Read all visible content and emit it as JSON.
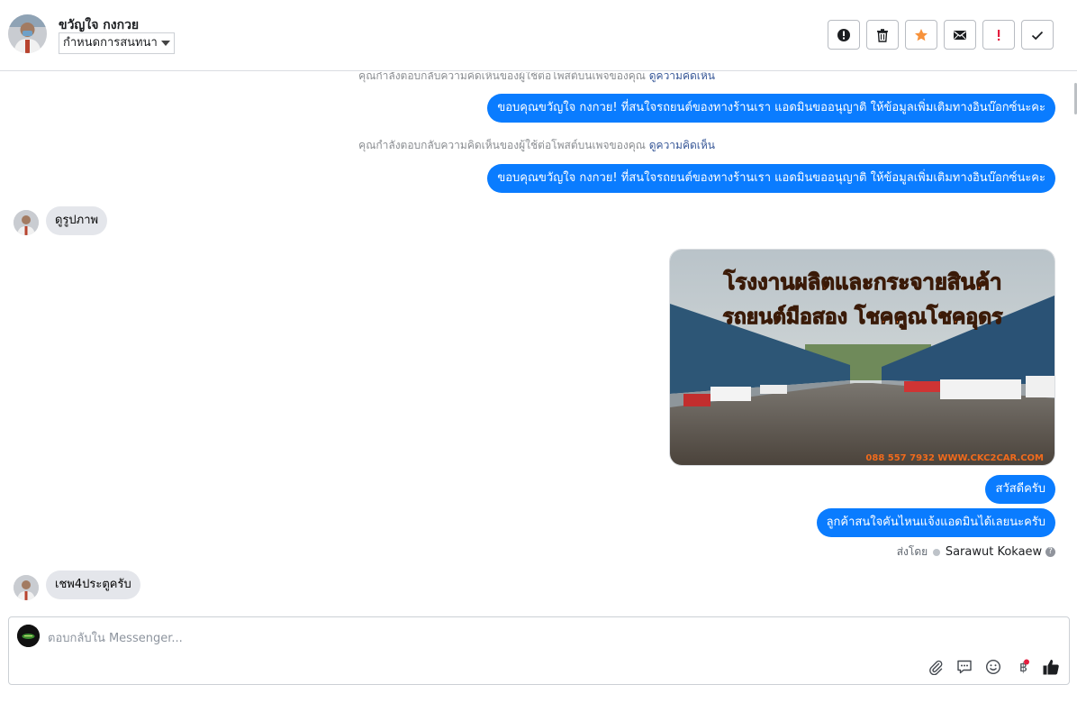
{
  "header": {
    "contact_name": "ขวัญใจ กงกวย",
    "conversation_select": "กำหนดการสนทนา",
    "toolbar": [
      {
        "name": "mark-spam-button",
        "icon": "alert-circle-icon"
      },
      {
        "name": "delete-button",
        "icon": "trash-icon"
      },
      {
        "name": "star-button",
        "icon": "star-icon",
        "color": "#f7923b"
      },
      {
        "name": "mark-unread-button",
        "icon": "envelope-icon"
      },
      {
        "name": "follow-up-button",
        "icon": "exclamation-icon",
        "color": "#e41e3f"
      },
      {
        "name": "mark-done-button",
        "icon": "checkmark-icon"
      }
    ]
  },
  "messages": {
    "sys1_text": "คุณกำลังตอบกลับความคิดเห็นของผู้ใช้ต่อโพสต์บนเพจของคุณ",
    "sys1_link": "ดูความคิดเห็น",
    "out1": "ขอบคุณขวัญใจ กงกวย! ที่สนใจรถยนต์ของทางร้านเรา แอดมินขออนุญาติ ให้ข้อมูลเพิ่มเติมทางอินบ๊อกซ์นะคะ",
    "sys2_text": "คุณกำลังตอบกลับความคิดเห็นของผู้ใช้ต่อโพสต์บนเพจของคุณ",
    "sys2_link": "ดูความคิดเห็น",
    "out2": "ขอบคุณขวัญใจ กงกวย! ที่สนใจรถยนต์ของทางร้านเรา แอดมินขออนุญาติ ให้ข้อมูลเพิ่มเติมทางอินบ๊อกซ์นะคะ",
    "in1": "ดูรูปภาพ",
    "photo": {
      "headline1": "โรงงานผลิตและกระจายสินค้า",
      "headline2": "รถยนต์มือสอง โชคคูณโชคอุดร",
      "footer": "088 557 7932 WWW.CKC2CAR.COM"
    },
    "out3": "สวัสดีครับ",
    "out4": "ลูกค้าสนใจคันไหนแจ้งแอดมินได้เลยนะครับ",
    "sent_by_label": "ส่งโดย",
    "sent_by_name": "Sarawut Kokaew",
    "in2": "เชพ4ประตูครับ"
  },
  "composer": {
    "placeholder": "ตอบกลับใน Messenger...",
    "icons": [
      "paperclip-icon",
      "saved-reply-icon",
      "emoji-icon",
      "baht-icon",
      "thumbs-up-icon"
    ]
  },
  "colors": {
    "accent": "#0a7cff",
    "incoming_bubble": "#e4e6eb",
    "link": "#385898"
  }
}
